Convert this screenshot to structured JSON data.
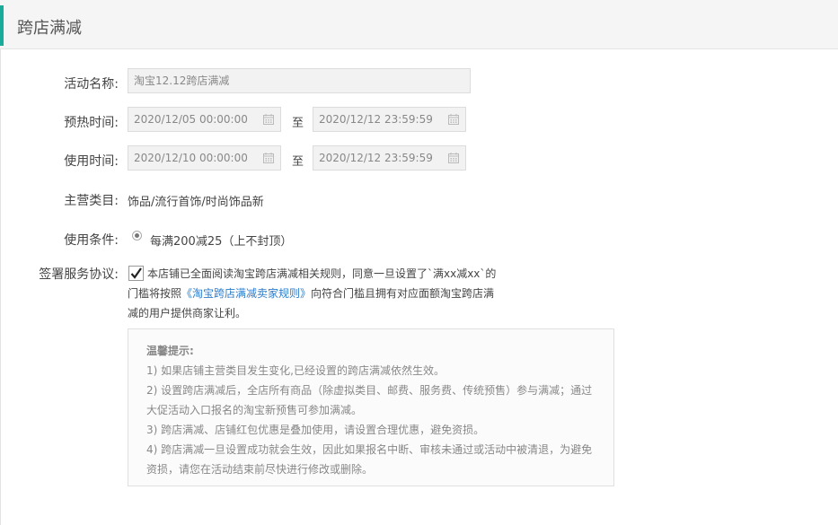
{
  "header": {
    "title": "跨店满减"
  },
  "form": {
    "name": {
      "label": "活动名称:",
      "value": "淘宝12.12跨店满减"
    },
    "preheat": {
      "label": "预热时间:",
      "start": "2020/12/05 00:00:00",
      "separator": "至",
      "end": "2020/12/12 23:59:59"
    },
    "usage": {
      "label": "使用时间:",
      "start": "2020/12/10 00:00:00",
      "separator": "至",
      "end": "2020/12/12 23:59:59"
    },
    "category": {
      "label": "主营类目:",
      "value": "饰品/流行首饰/时尚饰品新"
    },
    "condition": {
      "label": "使用条件:",
      "option": "每满200减25（上不封顶）"
    },
    "agreement": {
      "label": "签署服务协议:",
      "text_before": "本店铺已全面阅读淘宝跨店满减相关规则，同意一旦设置了`满xx减xx`的门槛将按照",
      "link": "《淘宝跨店满减卖家规则》",
      "text_after": "向符合门槛且拥有对应面额淘宝跨店满减的用户提供商家让利。"
    }
  },
  "tips": {
    "title": "温馨提示:",
    "items": [
      "1) 如果店铺主营类目发生变化,已经设置的跨店满减依然生效。",
      "2) 设置跨店满减后，全店所有商品（除虚拟类目、邮费、服务费、传统预售）参与满减；通过大促活动入口报名的淘宝新预售可参加满减。",
      "3) 跨店满减、店铺红包优惠是叠加使用，请设置合理优惠，避免资损。",
      "4) 跨店满减一旦设置成功就会生效，因此如果报名中断、审核未通过或活动中被清退，为避免资损，请您在活动结束前尽快进行修改或删除。"
    ]
  },
  "colors": {
    "accent": "#1aac9b",
    "link": "#2d7dcc"
  },
  "icons": {
    "date": "calendar-icon",
    "check": "checkmark-icon"
  }
}
